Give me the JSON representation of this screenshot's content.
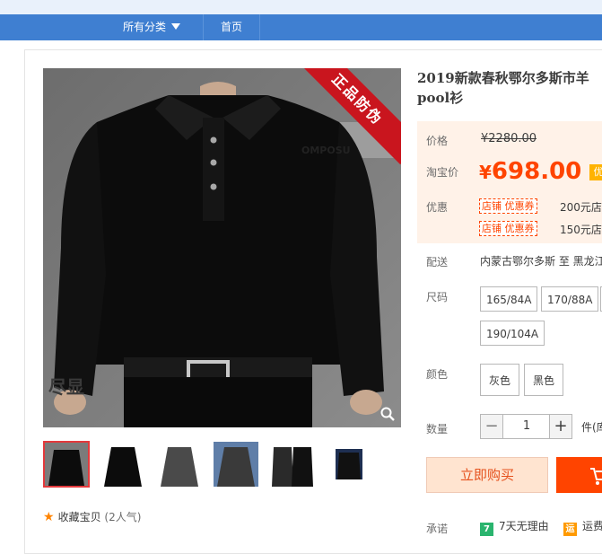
{
  "nav": {
    "categories_label": "所有分类",
    "home_label": "首页"
  },
  "product": {
    "title_line1": "2019新款春秋鄂尔多斯市羊",
    "title_line2": "pool衫",
    "image_badge": "正品防伪"
  },
  "price": {
    "original_label": "价格",
    "original_value": "¥2280.00",
    "current_label": "淘宝价",
    "currency": "¥",
    "current_value": "698.00",
    "tag": "优"
  },
  "promo": {
    "label": "优惠",
    "coupons": [
      {
        "tag": "店铺 优惠券",
        "text": "200元店"
      },
      {
        "tag": "店铺 优惠券",
        "text": "150元店"
      }
    ]
  },
  "delivery": {
    "label": "配送",
    "text": "内蒙古鄂尔多斯 至  黑龙江"
  },
  "size": {
    "label": "尺码",
    "options": [
      "165/84A",
      "170/88A",
      "190/104A"
    ]
  },
  "color": {
    "label": "颜色",
    "options": [
      "灰色",
      "黑色"
    ]
  },
  "quantity": {
    "label": "数量",
    "value": "1",
    "minus": "−",
    "plus": "+",
    "unit": "件(库"
  },
  "actions": {
    "buy_now": "立即购买"
  },
  "favorite": {
    "label": "收藏宝贝",
    "popularity": "(2人气)"
  },
  "promise": {
    "label": "承诺",
    "items": [
      {
        "icon": "7",
        "text": "7天无理由"
      },
      {
        "icon": "运",
        "text": "运费"
      }
    ]
  },
  "colors": {
    "nav": "#3f7fd1",
    "accent": "#ff4400",
    "coupon": "#ff4400",
    "badge": "#c9151e"
  }
}
